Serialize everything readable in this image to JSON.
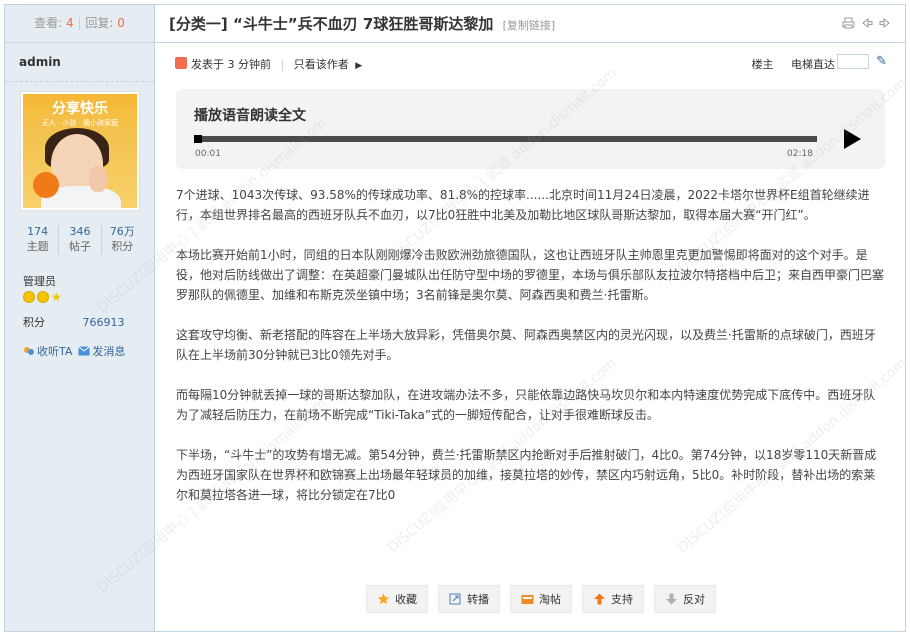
{
  "sidebar": {
    "views_label": "查看:",
    "views_value": "4",
    "replies_label": "回复:",
    "replies_value": "0",
    "username": "admin",
    "avatar_text": "分享快乐",
    "avatar_subtext": "无人 · 小孩 · 晚小孩家庭",
    "counts": [
      {
        "value": "174",
        "label": "主题"
      },
      {
        "value": "346",
        "label": "帖子"
      },
      {
        "value": "76万",
        "label": "积分"
      }
    ],
    "group": "管理员",
    "credits_label": "积分",
    "credits_value": "766913",
    "follow_label": "收听TA",
    "message_label": "发消息"
  },
  "post": {
    "category": "[分类一]",
    "title": "“斗牛士”兵不血刃 7球狂胜哥斯达黎加",
    "copy_link": "[复制链接]",
    "posted": "发表于 3 分钟前",
    "only_author": "只看该作者",
    "floor_label": "楼主",
    "jump_label": "电梯直达"
  },
  "audio": {
    "title": "播放语音朗读全文",
    "current_time": "00:01",
    "duration": "02:18",
    "progress": 0.01
  },
  "article": {
    "paragraphs": [
      "7个进球、1043次传球、93.58%的传球成功率、81.8%的控球率......北京时间11月24日凌晨，2022卡塔尔世界杯E组首轮继续进行，本组世界排名最高的西班牙队兵不血刃，以7比0狂胜中北美及加勒比地区球队哥斯达黎加，取得本届大赛“开门红”。",
      "本场比赛开始前1小时，同组的日本队刚刚爆冷击败欧洲劲旅德国队，这也让西班牙队主帅恩里克更加警惕即将面对的这个对手。是役，他对后防线做出了调整：在英超豪门曼城队出任防守型中场的罗德里，本场与俱乐部队友拉波尔特搭档中后卫；来自西甲豪门巴塞罗那队的佩德里、加维和布斯克茨坐镇中场；3名前锋是奥尔莫、阿森西奥和费兰·托雷斯。",
      "这套攻守均衡、新老搭配的阵容在上半场大放异彩，凭借奥尔莫、阿森西奥禁区内的灵光闪现，以及费兰·托雷斯的点球破门，西班牙队在上半场前30分钟就已3比0领先对手。",
      "而每隔10分钟就丢掉一球的哥斯达黎加队，在进攻端办法不多，只能依靠边路快马坎贝尔和本内特速度优势完成下底传中。西班牙队为了减轻后防压力，在前场不断完成“Tiki-Taka”式的一脚短传配合，让对手很难断球反击。",
      "下半场，“斗牛士”的攻势有增无减。第54分钟，费兰·托雷斯禁区内抢断对手后推射破门，4比0。第74分钟，以18岁零110天新晋成为西班牙国家队在世界杯和欧锦赛上出场最年轻球员的加维，接莫拉塔的妙传，禁区内巧射远角，5比0。补时阶段，替补出场的索莱尔和莫拉塔各进一球，将比分锁定在7比0"
    ]
  },
  "actions": [
    {
      "label": "收藏",
      "icon": "star-icon",
      "color": "#f5a623"
    },
    {
      "label": "转播",
      "icon": "share-icon",
      "color": "#4a7fc1"
    },
    {
      "label": "淘帖",
      "icon": "folder-icon",
      "color": "#f08a24"
    },
    {
      "label": "支持",
      "icon": "thumb-up-icon",
      "color": "#f07a18"
    },
    {
      "label": "反对",
      "icon": "thumb-down-icon",
      "color": "#999999"
    }
  ],
  "watermark": "DISCUZ!应用中心 | 武道 addon.dismall.com"
}
